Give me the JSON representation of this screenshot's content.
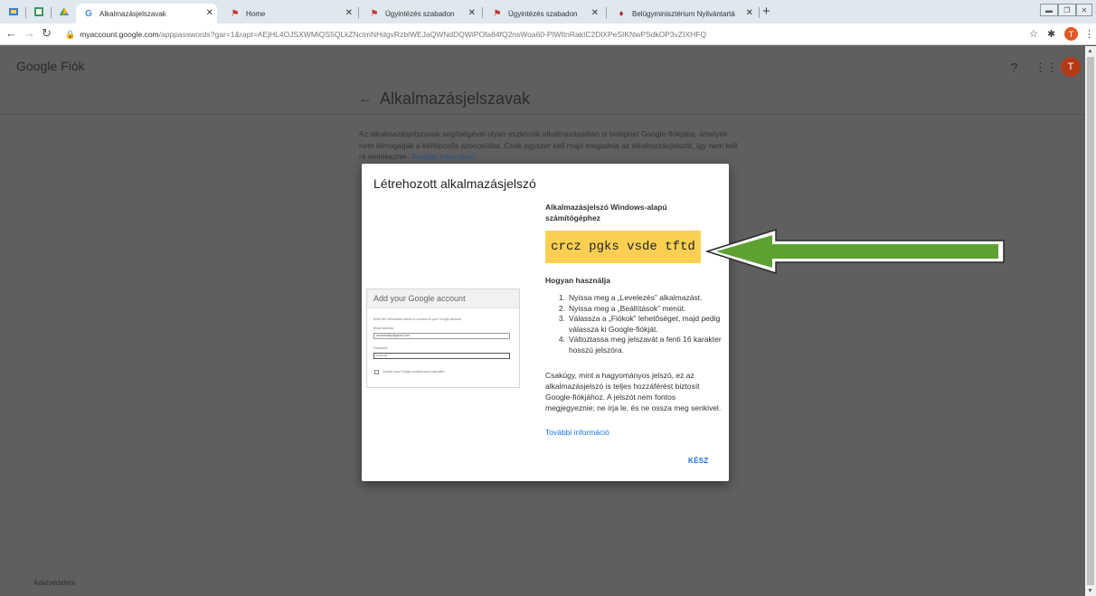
{
  "browser": {
    "tabs": [
      {
        "title": "Alkalmazásjelszavak",
        "active": true
      },
      {
        "title": "Home",
        "active": false
      },
      {
        "title": "Ügyintézés szabadon",
        "active": false
      },
      {
        "title": "Ügyintézés szabadon",
        "active": false
      },
      {
        "title": "Belügyminisztérium Nyilvántartá",
        "active": false
      }
    ],
    "url_host": "myaccount.google.com",
    "url_rest": "/apppasswords?gar=1&rapt=AEjHL4OJSXWMiQS5QLkZNclmNHdgvRzbiWEJaQWNdDQWiPOfa84fQ2nsWoa60-PlWItnRakIC2DlXPeSIKNwPSdkOP3vZIXHFQ",
    "profile_initial": "T"
  },
  "header": {
    "logo_google": "Google",
    "logo_product": "Fiók",
    "avatar_initial": "T"
  },
  "page": {
    "title": "Alkalmazásjelszavak",
    "intro": "Az alkalmazásjelszavak segítségével olyan eszközök alkalmazásaiban is beléphet Google-fiókjába, amelyek nem támogatják a kétlépcsős azonosítást. Csak egyszer kell majd megadnia az alkalmazásjelszót, így nem kell rá emlékeznie.",
    "intro_more": "További információ",
    "footer": "Adatvédelem"
  },
  "dialog": {
    "title": "Létrehozott alkalmazásjelszó",
    "device_label": "Alkalmazásjelszó Windows-alapú számítógéphez",
    "password": "crcz pgks vsde tftd",
    "howto_title": "Hogyan használja",
    "steps": [
      {
        "n": "1.",
        "text": "Nyissa meg a „Levelezés” alkalmazást."
      },
      {
        "n": "2.",
        "text": "Nyissa meg a „Beállítások” menüt."
      },
      {
        "n": "3.",
        "text": "Válassza a „Fiókok” lehetőséget, majd pedig válassza ki Google-fiókját."
      },
      {
        "n": "4.",
        "text": "Változtassa meg jelszavát a fenti 16 karakter hosszú jelszóra."
      }
    ],
    "notice": "Csakúgy, mint a hagyományos jelszó, ez az alkalmazásjelszó is teljes hozzáférést biztosít Google-fiókjához. A jelszót nem fontos megjegyeznie; ne írja le, és ne ossza meg senkivel.",
    "more": "További információ",
    "done": "KÉSZ",
    "mock": {
      "title": "Add your Google account",
      "instruction": "Enter the information below to connect to your Google account.",
      "email_label": "Email address",
      "email_value": "veruxesaby@gmail.com",
      "password_label": "Password",
      "password_value": "••••••••••",
      "checkbox_label": "Include your Google contacts and calendars"
    }
  },
  "colors": {
    "password_highlight": "#fbd052",
    "link": "#1a73e8",
    "arrow_fill": "#5ea133"
  }
}
